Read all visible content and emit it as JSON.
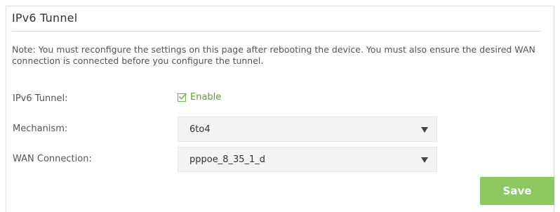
{
  "section": {
    "title": "IPv6 Tunnel"
  },
  "note": "Note: You must reconfigure the settings on this page after rebooting the device. You must also ensure the desired WAN connection is connected before you configure the tunnel.",
  "fields": {
    "tunnel": {
      "label": "IPv6 Tunnel:",
      "checkbox_label": "Enable",
      "checked": true
    },
    "mechanism": {
      "label": "Mechanism:",
      "value": "6to4"
    },
    "wan_connection": {
      "label": "WAN Connection:",
      "value": "pppoe_8_35_1_d"
    }
  },
  "actions": {
    "save_label": "Save"
  },
  "colors": {
    "accent_green": "#8bc860",
    "check_green": "#5aa02c"
  },
  "icons": {
    "checkbox": "checkbox-checked-icon",
    "dropdown": "chevron-down-icon"
  }
}
